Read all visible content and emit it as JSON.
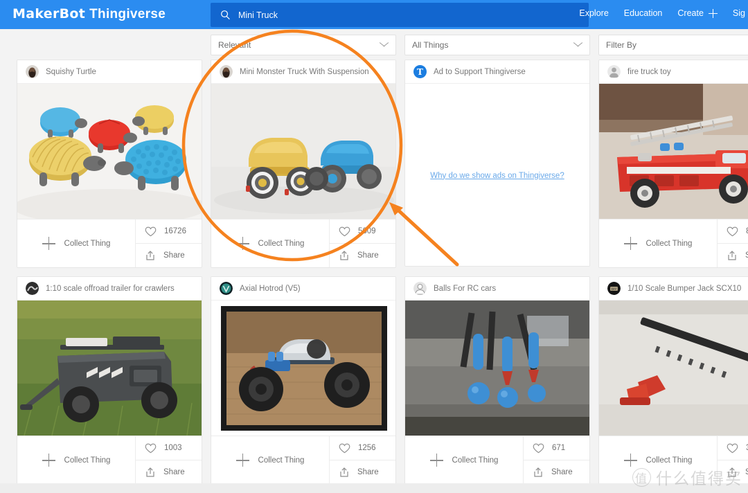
{
  "brand": {
    "part1": "MakerBot",
    "part2": "Thingiverse"
  },
  "search": {
    "value": "Mini Truck",
    "icon": "search-icon"
  },
  "nav": {
    "explore": "Explore",
    "education": "Education",
    "create": "Create",
    "signin": "Sig"
  },
  "filters": {
    "sort": "Relevant",
    "type": "All Things",
    "filter_by": "Filter By"
  },
  "labels": {
    "collect": "Collect Thing",
    "share": "Share",
    "heart_icon": "heart-icon",
    "share_icon": "share-icon"
  },
  "ad": {
    "title": "Ad to Support Thingiverse",
    "logo_letter": "T",
    "link": "Why do we show ads on Thingiverse?"
  },
  "cards": [
    {
      "title": "Squishy Turtle",
      "likes": "16726",
      "avatar": "dark-photo"
    },
    {
      "title": "Mini Monster Truck With Suspension",
      "likes": "5609",
      "avatar": "dark-photo"
    },
    {
      "title": "fire truck toy",
      "likes": "8",
      "avatar": "gray-person"
    },
    {
      "title": "1:10 scale offroad trailer for crawlers",
      "likes": "1003",
      "avatar": "dark-photo"
    },
    {
      "title": "Axial Hotrod (V5)",
      "likes": "1256",
      "avatar": "teal-logo"
    },
    {
      "title": "Balls For RC cars",
      "likes": "671",
      "avatar": "gray-person"
    },
    {
      "title": "1/10 Scale Bumper Jack SCX10",
      "likes": "3",
      "avatar": "dark-photo"
    }
  ],
  "annotation": {
    "color": "#f5821f",
    "shape": "circle-with-arrow",
    "target": "Mini Monster Truck With Suspension"
  },
  "watermark": {
    "mark": "值",
    "text": "什么值得买"
  }
}
